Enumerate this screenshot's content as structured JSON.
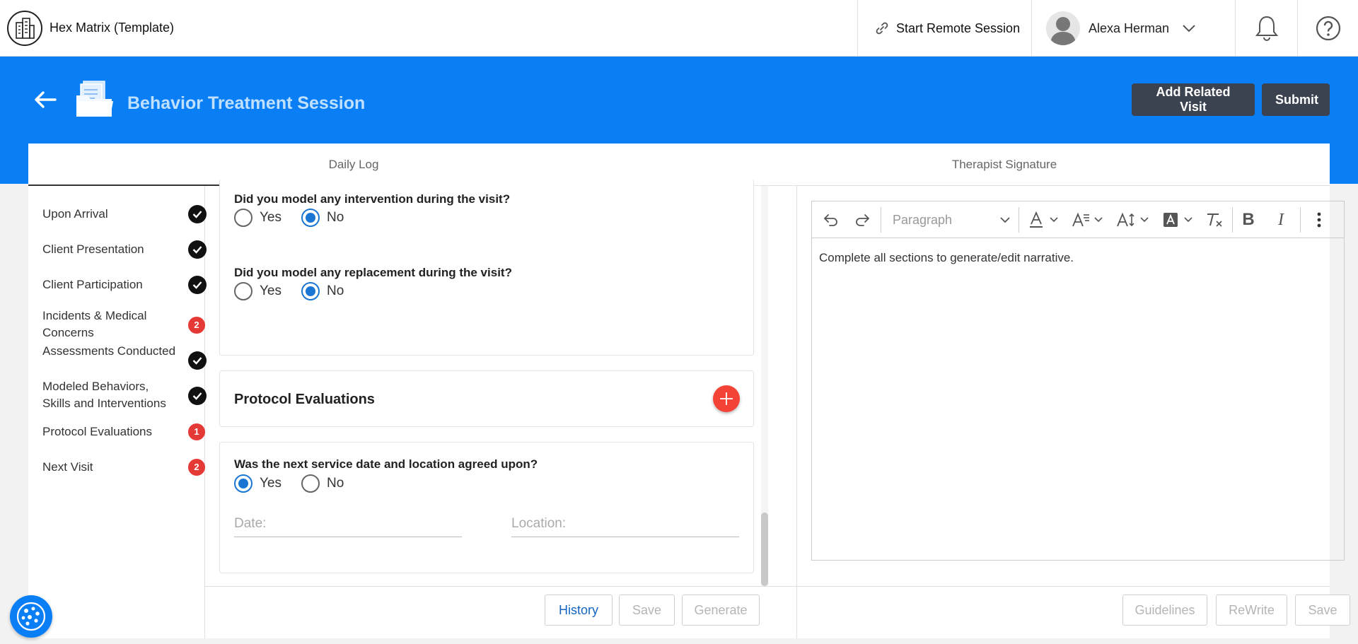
{
  "header": {
    "app_title": "Hex Matrix (Template)",
    "remote_label": "Start Remote Session",
    "user_name": "Alexa Herman"
  },
  "page": {
    "title": "Behavior Treatment Session",
    "add_related_label": "Add Related Visit",
    "submit_label": "Submit"
  },
  "tabs": [
    {
      "label": "Daily Log",
      "active": true
    },
    {
      "label": "Therapist Signature",
      "active": false
    }
  ],
  "sidebar": {
    "items": [
      {
        "label": "Upon Arrival",
        "status": "done"
      },
      {
        "label": "Client Presentation",
        "status": "done"
      },
      {
        "label": "Client Participation",
        "status": "done"
      },
      {
        "label": "Incidents & Medical Concerns",
        "status": "count",
        "count": "2"
      },
      {
        "label": "Assessments Conducted",
        "status": "done"
      },
      {
        "label": "Modeled Behaviors, Skills and Interventions",
        "status": "done"
      },
      {
        "label": "Protocol Evaluations",
        "status": "count",
        "count": "1"
      },
      {
        "label": "Next Visit",
        "status": "count",
        "count": "2"
      }
    ]
  },
  "form": {
    "q_intervention": "Did you model any intervention during the visit?",
    "q_replacement": "Did you model any replacement during the visit?",
    "yes_label": "Yes",
    "no_label": "No",
    "protocol_title": "Protocol Evaluations",
    "q_next_service": "Was the next service date and location agreed upon?",
    "date_placeholder": "Date:",
    "location_placeholder": "Location:",
    "answers": {
      "intervention": "No",
      "replacement": "No",
      "next_service": "Yes"
    },
    "history_label": "History",
    "save_label": "Save",
    "generate_label": "Generate"
  },
  "editor": {
    "paragraph_label": "Paragraph",
    "content": "Complete all sections to generate/edit narrative.",
    "guidelines_label": "Guidelines",
    "rewrite_label": "ReWrite",
    "save_label": "Save"
  },
  "colors": {
    "primary_blue": "#0a7ef5",
    "dark_button": "#3b4351",
    "badge_red": "#e53935",
    "radio_blue": "#1976d2"
  }
}
